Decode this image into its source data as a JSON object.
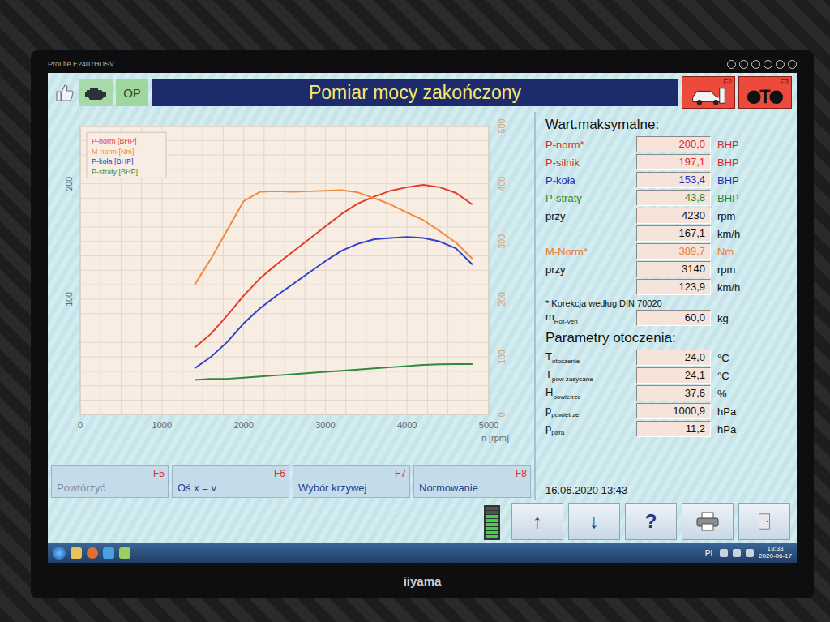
{
  "monitor": {
    "model": "ProLite E2407HDSV",
    "brand": "iiyama"
  },
  "header": {
    "title": "Pomiar mocy zakończony",
    "op_button": "OP",
    "keys": [
      {
        "key": "F2"
      },
      {
        "key": "F3"
      }
    ]
  },
  "chart": {
    "x_ticks": [
      "0",
      "1000",
      "2000",
      "3000",
      "4000",
      "5000"
    ],
    "x_label": "n [rpm]",
    "left_ticks": [
      "100",
      "200"
    ],
    "right_ticks": [
      "0",
      "100",
      "200",
      "300",
      "400",
      "500"
    ],
    "rpm": [
      1400,
      1600,
      1800,
      2000,
      2200,
      2400,
      2600,
      2800,
      3000,
      3200,
      3400,
      3600,
      3800,
      4000,
      4200,
      4400,
      4600,
      4800
    ],
    "series": [
      {
        "label": "P-norm [BHP]",
        "axis": "left",
        "color": "#e03c28",
        "values": [
          58,
          70,
          86,
          103,
          118,
          130,
          141,
          152,
          163,
          174,
          183,
          189,
          194,
          197,
          199,
          197,
          192,
          182
        ]
      },
      {
        "label": "M-norm [Nm]",
        "axis": "right",
        "color": "#f0893c",
        "values": [
          225,
          270,
          320,
          370,
          386,
          387,
          386,
          387,
          388,
          389,
          385,
          375,
          364,
          350,
          337,
          318,
          298,
          270
        ]
      },
      {
        "label": "P-koła [BHP]",
        "axis": "left",
        "color": "#3040c8",
        "values": [
          40,
          50,
          63,
          79,
          92,
          103,
          113,
          123,
          133,
          142,
          148,
          152,
          153,
          154,
          153,
          150,
          144,
          130
        ]
      },
      {
        "label": "P-straty [BHP]",
        "axis": "left",
        "color": "#2e8b3a",
        "values": [
          30,
          31,
          31,
          32,
          33,
          34,
          35,
          36,
          37,
          38,
          39,
          40,
          41,
          42,
          43,
          43.5,
          43.8,
          43.8
        ]
      }
    ]
  },
  "max_values": {
    "heading": "Wart.maksymalne:",
    "rows": [
      {
        "label": "P-norm*",
        "value": "200,0",
        "unit": "BHP",
        "color": "#e02828"
      },
      {
        "label": "P-silnik",
        "value": "197,1",
        "unit": "BHP",
        "color": "#e02828"
      },
      {
        "label": "P-koła",
        "value": "153,4",
        "unit": "BHP",
        "color": "#2030c0"
      },
      {
        "label": "P-straty",
        "value": "43,8",
        "unit": "BHP",
        "color": "#1e8a2e"
      },
      {
        "label": "przy",
        "value": "4230",
        "unit": "rpm",
        "color": "#111111"
      },
      {
        "label": "",
        "value": "167,1",
        "unit": "km/h",
        "color": "#111111"
      },
      {
        "label": "M-Norm*",
        "value": "389,7",
        "unit": "Nm",
        "color": "#f07a28"
      },
      {
        "label": "przy",
        "value": "3140",
        "unit": "rpm",
        "color": "#111111"
      },
      {
        "label": "",
        "value": "123,9",
        "unit": "km/h",
        "color": "#111111"
      }
    ],
    "note": "* Korekcja według DIN 70020",
    "mass": {
      "label": "m",
      "sub": "Rot-Veh",
      "value": "60,0",
      "unit": "kg"
    }
  },
  "ambient": {
    "heading": "Parametry otoczenia:",
    "rows": [
      {
        "label": "T",
        "sub": "otoczenie",
        "value": "24,0",
        "unit": "°C"
      },
      {
        "label": "T",
        "sub": "pow zasysane",
        "value": "24,1",
        "unit": "°C"
      },
      {
        "label": "H",
        "sub": "powietrze",
        "value": "37,6",
        "unit": "%"
      },
      {
        "label": "p",
        "sub": "powietrze",
        "value": "1000,9",
        "unit": "hPa"
      },
      {
        "label": "p",
        "sub": "para",
        "value": "11,2",
        "unit": "hPa"
      }
    ]
  },
  "date": "16.06.2020 13:43",
  "function_keys": [
    {
      "label": "Powtórzyć",
      "key": "F5",
      "disabled": true
    },
    {
      "label": "Oś x = v",
      "key": "F6",
      "disabled": false
    },
    {
      "label": "Wybór krzywej",
      "key": "F7",
      "disabled": false
    },
    {
      "label": "Normowanie",
      "key": "F8",
      "disabled": false
    }
  ],
  "indicator": {
    "level": 0.75
  },
  "nav_buttons": [
    "↑",
    "↓",
    "?"
  ],
  "taskbar": {
    "language": "PL",
    "time": "13:33",
    "date": "2020-06-17"
  }
}
